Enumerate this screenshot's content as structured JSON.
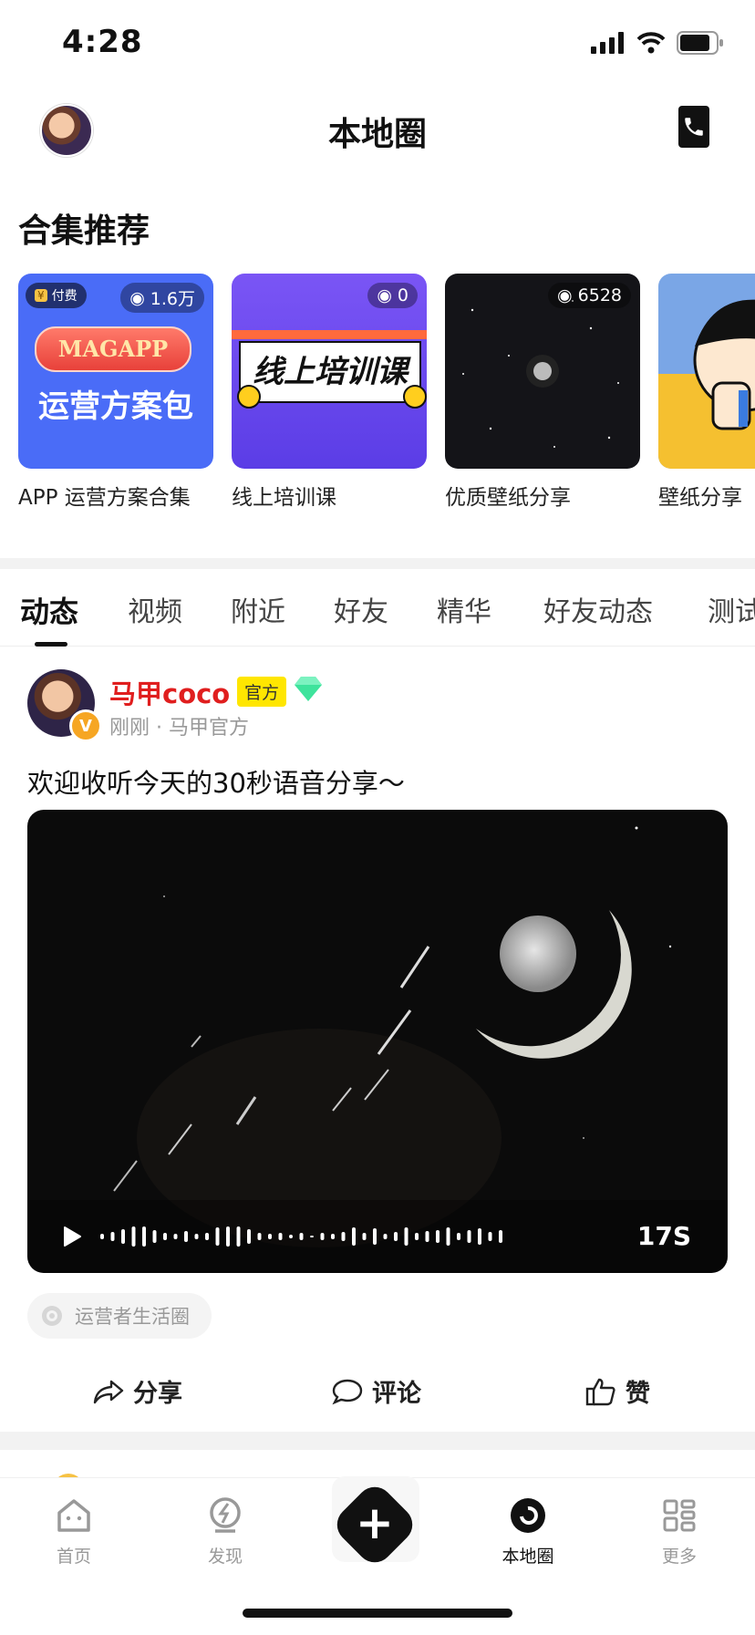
{
  "status_bar": {
    "time": "4:28"
  },
  "header": {
    "title": "本地圈"
  },
  "collections": {
    "title": "合集推荐",
    "items": [
      {
        "label": "APP 运营方案合集",
        "views": "1.6万",
        "paid_tag": "付费",
        "cover_brand": "MAGAPP",
        "cover_text": "运营方案包"
      },
      {
        "label": "线上培训课",
        "views": "0",
        "cover_text": "线上培训课"
      },
      {
        "label": "优质壁纸分享",
        "views": "6528"
      },
      {
        "label": "壁纸分享"
      }
    ]
  },
  "tabs": [
    "动态",
    "视频",
    "附近",
    "好友",
    "精华",
    "好友动态",
    "测试"
  ],
  "active_tab": "动态",
  "post": {
    "author": "马甲coco",
    "official_badge": "官方",
    "verify_mark": "V",
    "meta": "刚刚 · 马甲官方",
    "text": "欢迎收听今天的30秒语音分享～",
    "audio_duration": "17S",
    "topic": "运营者生活圈",
    "actions": {
      "share": "分享",
      "comment": "评论",
      "like": "赞"
    }
  },
  "bottom_nav": {
    "items": [
      {
        "label": "首页",
        "icon": "home-icon"
      },
      {
        "label": "发现",
        "icon": "discover-icon"
      },
      {
        "label": "",
        "icon": "plus-icon"
      },
      {
        "label": "本地圈",
        "icon": "local-circle-icon"
      },
      {
        "label": "更多",
        "icon": "grid-icon"
      }
    ],
    "active": "本地圈"
  },
  "colors": {
    "accent": "#111111",
    "author_name": "#e01e1e",
    "official_badge": "#ffe600",
    "card1": "#4a6cf7",
    "card2": "#6a4cf0"
  }
}
